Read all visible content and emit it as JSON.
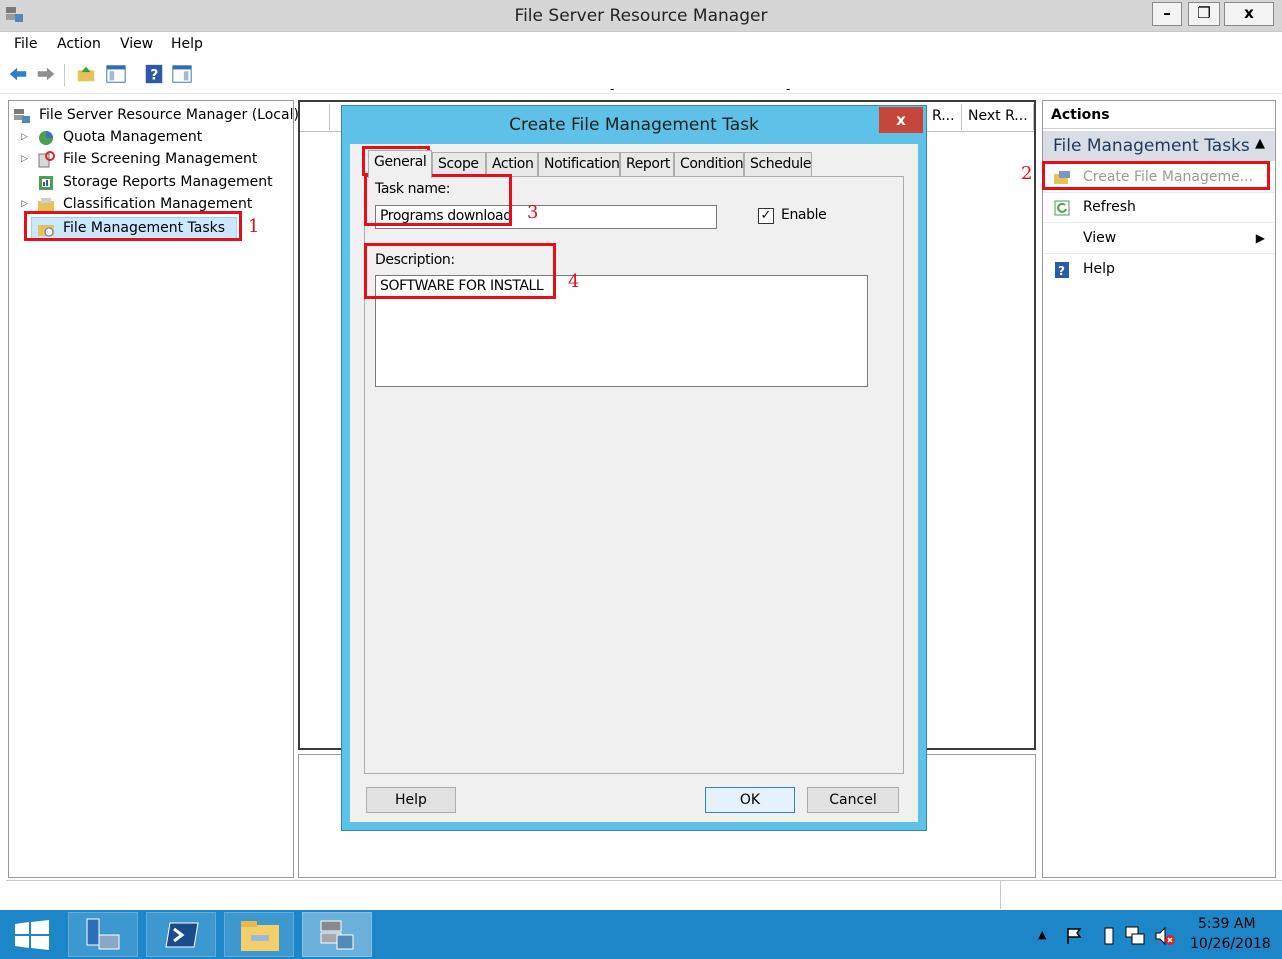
{
  "window": {
    "title": "File Server Resource Manager",
    "minimize": "–",
    "restore": "❐",
    "close": "x"
  },
  "menu": [
    "File",
    "Action",
    "View",
    "Help"
  ],
  "tree": {
    "root": "File Server Resource Manager (Local)",
    "items": [
      {
        "label": "Quota Management",
        "expandable": true
      },
      {
        "label": "File Screening Management",
        "expandable": true
      },
      {
        "label": "Storage Reports Management",
        "expandable": false
      },
      {
        "label": "Classification Management",
        "expandable": true
      },
      {
        "label": "File Management Tasks",
        "expandable": false,
        "selected": true
      }
    ]
  },
  "center": {
    "columns": [
      "R...",
      "Next R..."
    ],
    "sort_marks": [
      "-",
      "-"
    ]
  },
  "actions": {
    "header": "Actions",
    "section": "File Management Tasks",
    "items": [
      {
        "label": "Create File Manageme...",
        "icon": "task-create-icon",
        "disabled": true
      },
      {
        "label": "Refresh",
        "icon": "refresh-icon"
      },
      {
        "label": "View",
        "icon": "",
        "submenu": true
      },
      {
        "label": "Help",
        "icon": "help-icon"
      }
    ]
  },
  "dialog": {
    "title": "Create File Management Task",
    "close": "x",
    "tabs": [
      "General",
      "Scope",
      "Action",
      "Notification",
      "Report",
      "Condition",
      "Schedule"
    ],
    "active_tab": "General",
    "task_name_label": "Task name:",
    "task_name_value": "Programs download",
    "enable_label": "Enable",
    "enable_checked": true,
    "description_label": "Description:",
    "description_value": "SOFTWARE FOR INSTALL",
    "help_button": "Help",
    "ok_button": "OK",
    "cancel_button": "Cancel"
  },
  "annotations": [
    "1",
    "2",
    "3",
    "4"
  ],
  "taskbar": {
    "time": "5:39 AM",
    "date": "10/26/2018"
  },
  "colors": {
    "highlight": "#e3101a",
    "dialog_frame": "#5ec1e8",
    "taskbar": "#1c86c8"
  }
}
